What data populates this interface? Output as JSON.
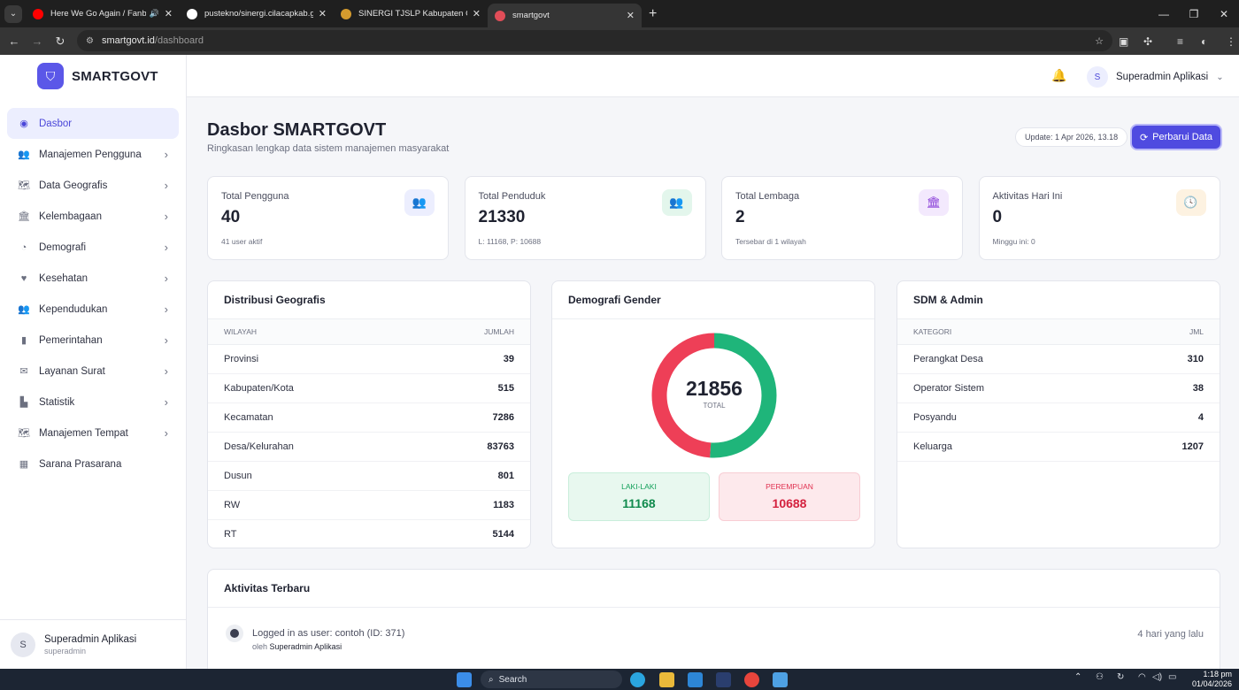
{
  "browser": {
    "tabs": [
      {
        "title": "Here We Go Again / Fanboi",
        "favicon": "youtube-icon",
        "color": "#ff0000",
        "sound": true,
        "active": false
      },
      {
        "title": "pustekno/sinergi.cilacapkab.go",
        "favicon": "github-icon",
        "color": "#ffffff",
        "sound": false,
        "active": false
      },
      {
        "title": "SINERGI TJSLP Kabupaten Cilac",
        "favicon": "emblem-icon",
        "color": "#d59b2e",
        "sound": false,
        "active": false
      },
      {
        "title": "smartgovt",
        "favicon": "x-logo-icon",
        "color": "#e14d58",
        "sound": false,
        "active": true
      }
    ],
    "url_host": "smartgovt.id",
    "url_path": "/dashboard"
  },
  "sidebar": {
    "brand": "SMARTGOVT",
    "items": [
      {
        "label": "Dasbor",
        "icon": "dashboard-icon",
        "glyph": "◉",
        "active": true,
        "chevron": false
      },
      {
        "label": "Manajemen Pengguna",
        "icon": "users-icon",
        "glyph": "👥",
        "active": false,
        "chevron": true
      },
      {
        "label": "Data Geografis",
        "icon": "map-icon",
        "glyph": "🗺",
        "active": false,
        "chevron": true
      },
      {
        "label": "Kelembagaan",
        "icon": "institution-icon",
        "glyph": "🏛",
        "active": false,
        "chevron": true
      },
      {
        "label": "Demografi",
        "icon": "pie-chart-icon",
        "glyph": "◔",
        "active": false,
        "chevron": true
      },
      {
        "label": "Kesehatan",
        "icon": "heartbeat-icon",
        "glyph": "♥",
        "active": false,
        "chevron": true
      },
      {
        "label": "Kependudukan",
        "icon": "people-icon",
        "glyph": "👥",
        "active": false,
        "chevron": true
      },
      {
        "label": "Pemerintahan",
        "icon": "building-icon",
        "glyph": "▮",
        "active": false,
        "chevron": true
      },
      {
        "label": "Layanan Surat",
        "icon": "envelope-icon",
        "glyph": "✉",
        "active": false,
        "chevron": true
      },
      {
        "label": "Statistik",
        "icon": "bar-chart-icon",
        "glyph": "▙",
        "active": false,
        "chevron": true
      },
      {
        "label": "Manajemen Tempat",
        "icon": "map-icon",
        "glyph": "🗺",
        "active": false,
        "chevron": true
      },
      {
        "label": "Sarana Prasarana",
        "icon": "city-icon",
        "glyph": "▦",
        "active": false,
        "chevron": false
      }
    ],
    "user": {
      "initial": "S",
      "name": "Superadmin Aplikasi",
      "role": "superadmin"
    }
  },
  "topbar": {
    "user_initial": "S",
    "user_name": "Superadmin Aplikasi"
  },
  "header": {
    "title": "Dasbor SMARTGOVT",
    "subtitle": "Ringkasan lengkap data sistem manajemen masyarakat",
    "update_text": "Update: 1 Apr 2026, 13.18",
    "refresh_label": "Perbarui Data"
  },
  "stats": [
    {
      "label": "Total Pengguna",
      "value": "40",
      "sub": "41 user aktif",
      "icon": "users-icon",
      "glyph": "👥",
      "bg": "#eceefe",
      "fg": "#4b47d9"
    },
    {
      "label": "Total Penduduk",
      "value": "21330",
      "sub": "L: 11168, P: 10688",
      "icon": "people-icon",
      "glyph": "👥",
      "bg": "#e3f6ec",
      "fg": "#13a05a"
    },
    {
      "label": "Total Lembaga",
      "value": "2",
      "sub": "Tersebar di 1 wilayah",
      "icon": "institution-icon",
      "glyph": "🏛",
      "bg": "#f3e9fd",
      "fg": "#8a3fd8"
    },
    {
      "label": "Aktivitas Hari Ini",
      "value": "0",
      "sub": "Minggu ini: 0",
      "icon": "clock-icon",
      "glyph": "🕓",
      "bg": "#fdf2e1",
      "fg": "#e08a12"
    }
  ],
  "geo": {
    "title": "Distribusi Geografis",
    "col1": "WILAYAH",
    "col2": "JUMLAH",
    "rows": [
      {
        "name": "Provinsi",
        "value": "39"
      },
      {
        "name": "Kabupaten/Kota",
        "value": "515"
      },
      {
        "name": "Kecamatan",
        "value": "7286"
      },
      {
        "name": "Desa/Kelurahan",
        "value": "83763"
      },
      {
        "name": "Dusun",
        "value": "801"
      },
      {
        "name": "RW",
        "value": "1183"
      },
      {
        "name": "RT",
        "value": "5144"
      }
    ]
  },
  "gender": {
    "title": "Demografi Gender",
    "total": "21856",
    "total_label": "TOTAL",
    "male_label": "LAKI-LAKI",
    "male_value": "11168",
    "female_label": "PEREMPUAN",
    "female_value": "10688",
    "male_color": "#1fb57a",
    "female_color": "#ee3f57"
  },
  "sdm": {
    "title": "SDM & Admin",
    "col1": "KATEGORI",
    "col2": "JML",
    "rows": [
      {
        "name": "Perangkat Desa",
        "value": "310"
      },
      {
        "name": "Operator Sistem",
        "value": "38"
      },
      {
        "name": "Posyandu",
        "value": "4"
      },
      {
        "name": "Keluarga",
        "value": "1207"
      }
    ]
  },
  "activity": {
    "title": "Aktivitas Terbaru",
    "items": [
      {
        "text": "Logged in as user: contoh (ID: 371)",
        "by_prefix": "oleh",
        "by": "Superadmin Aplikasi",
        "time": "4 hari yang lalu"
      }
    ]
  },
  "taskbar": {
    "search_label": "Search",
    "time": "1:18 pm",
    "date": "01/04/2026"
  }
}
